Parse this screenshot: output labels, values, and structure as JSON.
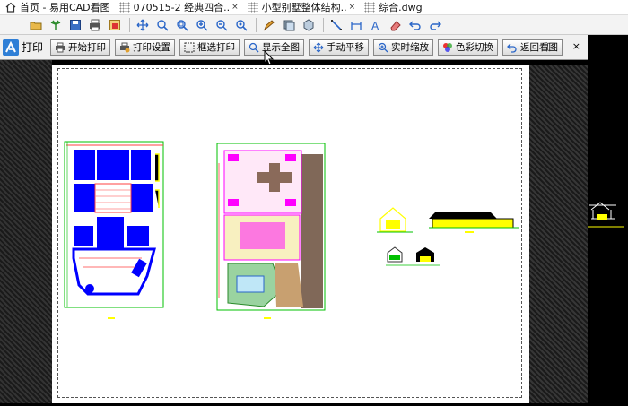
{
  "tabs": [
    {
      "label": "首页 - 易用CAD看图",
      "closable": false
    },
    {
      "label": "070515-2 经典四合..",
      "closable": true
    },
    {
      "label": "小型别墅整体结构..",
      "closable": true
    },
    {
      "label": "综合.dwg",
      "closable": false
    }
  ],
  "print_window": {
    "title": "打印",
    "buttons": [
      {
        "label": "开始打印",
        "icon": "printer-icon"
      },
      {
        "label": "打印设置",
        "icon": "print-settings-icon"
      },
      {
        "label": "框选打印",
        "icon": "box-select-icon"
      },
      {
        "label": "显示全图",
        "icon": "fit-view-icon"
      },
      {
        "label": "手动平移",
        "icon": "pan-icon"
      },
      {
        "label": "实时缩放",
        "icon": "zoom-icon"
      },
      {
        "label": "色彩切换",
        "icon": "color-switch-icon"
      },
      {
        "label": "返回看图",
        "icon": "return-icon"
      }
    ],
    "minimize": "□",
    "close": "×"
  },
  "colors": {
    "accent": "#2f7fd6",
    "cad_blue": "#0000ff",
    "cad_magenta": "#ff00ff",
    "cad_yellow": "#ffff00",
    "cad_green": "#00c000"
  }
}
